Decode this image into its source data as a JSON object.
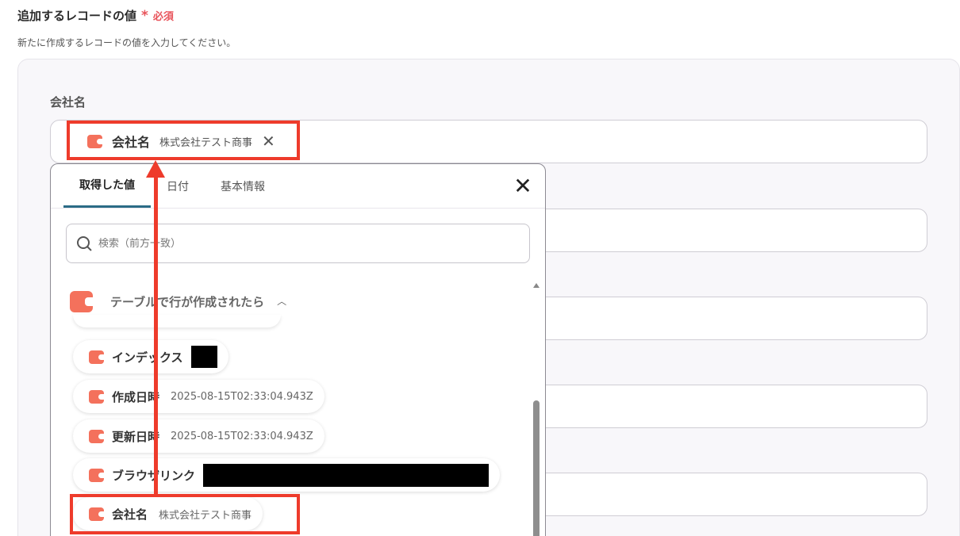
{
  "section": {
    "title": "追加するレコードの値",
    "required_star": "*",
    "required_label": "必須",
    "description": "新たに作成するレコードの値を入力してください。"
  },
  "field": {
    "label": "会社名",
    "chip": {
      "icon": "coda-app-icon",
      "name": "会社名",
      "value": "株式会社テスト商事",
      "remove_icon": "close-icon"
    }
  },
  "dropdown": {
    "tabs": [
      {
        "label": "取得した値",
        "active": true
      },
      {
        "label": "日付",
        "active": false
      },
      {
        "label": "基本情報",
        "active": false
      }
    ],
    "close_icon": "close-icon",
    "search": {
      "icon": "search-icon",
      "placeholder": "検索（前方一致）"
    },
    "group": {
      "icon": "coda-app-icon",
      "title": "テーブルで行が作成されたら",
      "expanded": true,
      "toggle_icon": "chevron-up-icon"
    },
    "items": [
      {
        "name": "インデックス",
        "value": "",
        "redacted": true
      },
      {
        "name": "作成日時",
        "value": "2025-08-15T02:33:04.943Z",
        "redacted": false
      },
      {
        "name": "更新日時",
        "value": "2025-08-15T02:33:04.943Z",
        "redacted": false
      },
      {
        "name": "ブラウザリンク",
        "value": "",
        "redacted": true
      },
      {
        "name": "会社名",
        "value": "株式会社テスト商事",
        "redacted": false
      }
    ]
  },
  "colors": {
    "accent_red": "#ee3b2b",
    "required_red": "#e8545b",
    "app_icon": "#f4715c",
    "tab_underline": "#2b6c86"
  }
}
